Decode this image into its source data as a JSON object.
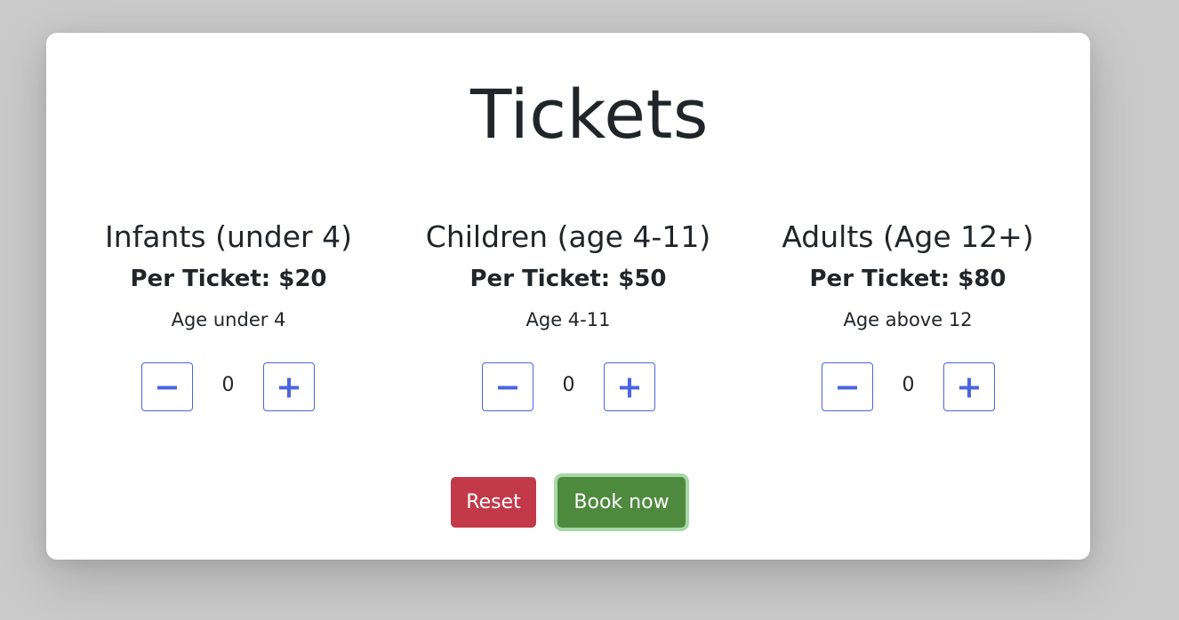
{
  "page_title": "Tickets",
  "categories": [
    {
      "name": "Infants (under 4)",
      "price": "Per Ticket: $20",
      "age_note": "Age under 4",
      "count": "0"
    },
    {
      "name": "Children (age 4-11)",
      "price": "Per Ticket: $50",
      "age_note": "Age 4-11",
      "count": "0"
    },
    {
      "name": "Adults (Age 12+)",
      "price": "Per Ticket: $80",
      "age_note": "Age above 12",
      "count": "0"
    }
  ],
  "actions": {
    "reset_label": "Reset",
    "book_label": "Book now"
  },
  "icons": {
    "decrement": "minus-icon",
    "increment": "plus-icon"
  },
  "colors": {
    "background": "#cacaca",
    "card": "#ffffff",
    "text": "#212529",
    "stepper_accent": "#4a64e2",
    "reset": "#c23a4a",
    "book": "#4e8a3e",
    "book_focus_ring": "#a8d8a6"
  }
}
